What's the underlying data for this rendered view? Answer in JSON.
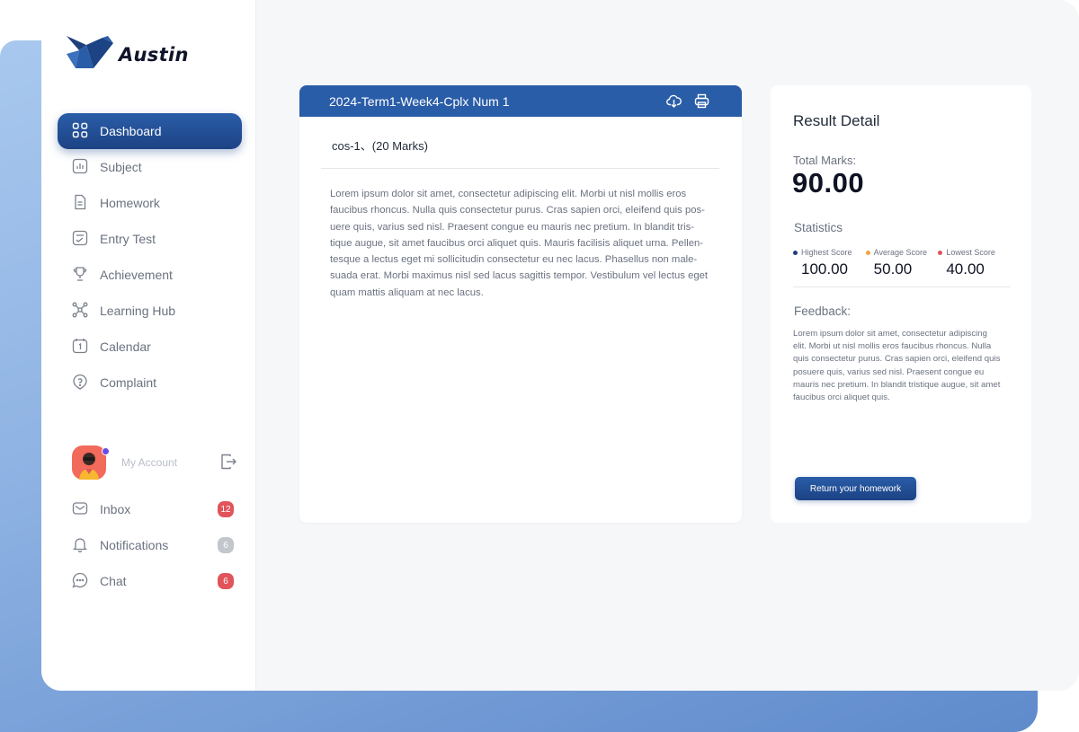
{
  "brand": {
    "name": "Austin"
  },
  "sidebar": {
    "items": [
      {
        "label": "Dashboard",
        "icon": "grid-icon",
        "active": true
      },
      {
        "label": "Subject",
        "icon": "chart-icon"
      },
      {
        "label": "Homework",
        "icon": "document-icon"
      },
      {
        "label": "Entry Test",
        "icon": "checklist-icon"
      },
      {
        "label": "Achievement",
        "icon": "trophy-icon"
      },
      {
        "label": "Learning Hub",
        "icon": "network-icon"
      },
      {
        "label": "Calendar",
        "icon": "calendar-icon"
      },
      {
        "label": "Complaint",
        "icon": "support-icon"
      }
    ],
    "account": {
      "label": "My Account"
    },
    "bottom_items": [
      {
        "label": "Inbox",
        "icon": "mail-icon",
        "badge": "12",
        "badge_color": "#e0545a"
      },
      {
        "label": "Notifications",
        "icon": "bell-icon",
        "badge": "6",
        "badge_color": "#c2c6cd"
      },
      {
        "label": "Chat",
        "icon": "chat-icon",
        "badge": "6",
        "badge_color": "#e0545a"
      }
    ]
  },
  "assignment": {
    "title": "2024-Term1-Week4-Cplx Num 1",
    "question": "cos-1、(20 Marks)",
    "body": "Lorem ipsum dolor sit amet, consectetur adipiscing elit. Morbi ut nisl mollis eros faucibus rhoncus. Nulla quis consectetur purus. Cras sapien orci, eleifend quis pos-uere quis, varius sed nisl. Praesent congue eu mauris nec pretium. In blandit tris-tique augue, sit amet faucibus orci aliquet quis. Mauris facilisis aliquet urna. Pellen-tesque a lectus eget mi sollicitudin consectetur eu nec lacus. Phasellus non male-suada erat. Morbi maximus nisl sed lacus sagittis tempor. Vestibulum vel lectus eget quam mattis aliquam at nec lacus."
  },
  "result": {
    "title": "Result Detail",
    "total_label": "Total Marks:",
    "total_value": "90.00",
    "stats_label": "Statistics",
    "stats": [
      {
        "label": "Highest Score",
        "value": "100.00",
        "color": "#1f3f7a"
      },
      {
        "label": "Average Score",
        "value": "50.00",
        "color": "#f2a444"
      },
      {
        "label": "Lowest Score",
        "value": "40.00",
        "color": "#e0545a"
      }
    ],
    "feedback_label": "Feedback:",
    "feedback": "Lorem ipsum dolor sit amet, consectetur adipiscing elit. Morbi ut nisl mollis eros faucibus rhoncus. Nulla quis consectetur purus. Cras sapien orci, eleifend quis posuere quis, varius sed nisl. Praesent congue eu mauris nec pretium. In blandit tristique augue, sit amet faucibus orci aliquet quis.",
    "return_button": "Return your homework"
  },
  "colors": {
    "accent": "#2a5da8",
    "accent_dark": "#1c4384"
  }
}
